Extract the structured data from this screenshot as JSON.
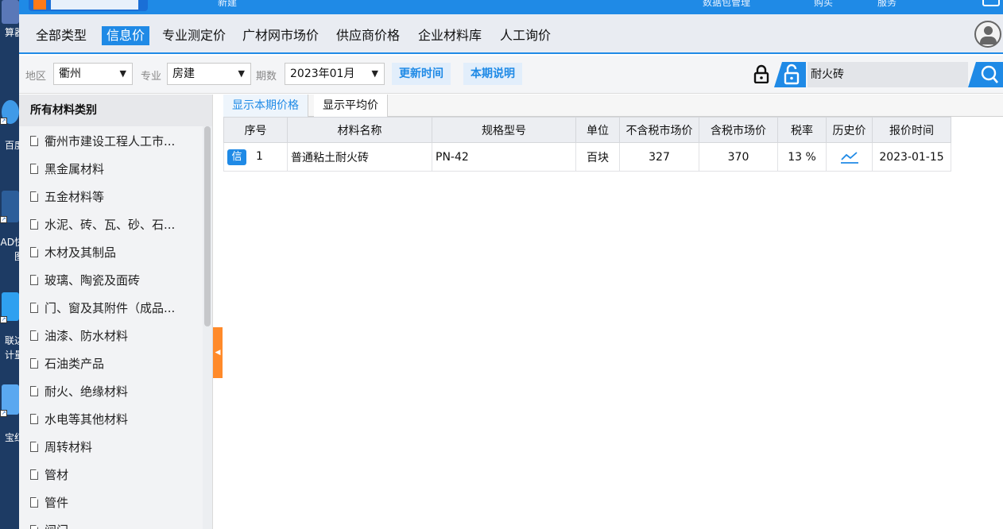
{
  "desktop": {
    "icons": [
      {
        "label": "算器",
        "color": "#5a78b8"
      },
      {
        "label": "百度",
        "color": "#3f9ae8"
      },
      {
        "label": "AD快",
        "color": "#2c5e9a"
      },
      {
        "label": "图",
        "color": "#2c5e9a"
      },
      {
        "label": "联达",
        "color": "#2fa0f0"
      },
      {
        "label": "计量",
        "color": "#2fa0f0"
      },
      {
        "label": "宝红",
        "color": "#5aa8f0"
      }
    ]
  },
  "topbar": {
    "fragments": [
      "新建",
      "数据包管理",
      "购买",
      "服务"
    ]
  },
  "tabs": [
    {
      "label": "全部类型",
      "active": false
    },
    {
      "label": "信息价",
      "active": true
    },
    {
      "label": "专业测定价",
      "active": false
    },
    {
      "label": "广材网市场价",
      "active": false
    },
    {
      "label": "供应商价格",
      "active": false
    },
    {
      "label": "企业材料库",
      "active": false
    },
    {
      "label": "人工询价",
      "active": false
    }
  ],
  "filters": {
    "region_label": "地区",
    "region_value": "衢州",
    "major_label": "专业",
    "major_value": "房建",
    "period_label": "期数",
    "period_value": "2023年01月",
    "update_time_btn": "更新时间",
    "period_note_btn": "本期说明",
    "search_value": "耐火砖",
    "search_placeholder": "耐火砖"
  },
  "categories": {
    "title": "所有材料类别",
    "items": [
      "衢州市建设工程人工市...",
      "黑金属材料",
      "五金材料等",
      "水泥、砖、瓦、砂、石...",
      "木材及其制品",
      "玻璃、陶瓷及面砖",
      "门、窗及其附件（成品...",
      "油漆、防水材料",
      "石油类产品",
      "耐火、绝缘材料",
      "水电等其他材料",
      "周转材料",
      "管材",
      "管件",
      "阀门"
    ]
  },
  "subtabs": [
    {
      "label": "显示本期价格",
      "active": true
    },
    {
      "label": "显示平均价",
      "active": false
    }
  ],
  "table": {
    "headers": [
      "序号",
      "材料名称",
      "规格型号",
      "单位",
      "不含税市场价",
      "含税市场价",
      "税率",
      "历史价",
      "报价时间"
    ],
    "rows": [
      {
        "badge": "信",
        "index": "1",
        "name": "普通粘土耐火砖",
        "spec": "PN-42",
        "unit": "百块",
        "price_ex_tax": "327",
        "price_in_tax": "370",
        "tax_rate": "13 %",
        "quote_date": "2023-01-15"
      }
    ]
  },
  "colors": {
    "accent": "#1f8ae6",
    "handle": "#ff8a2a"
  }
}
